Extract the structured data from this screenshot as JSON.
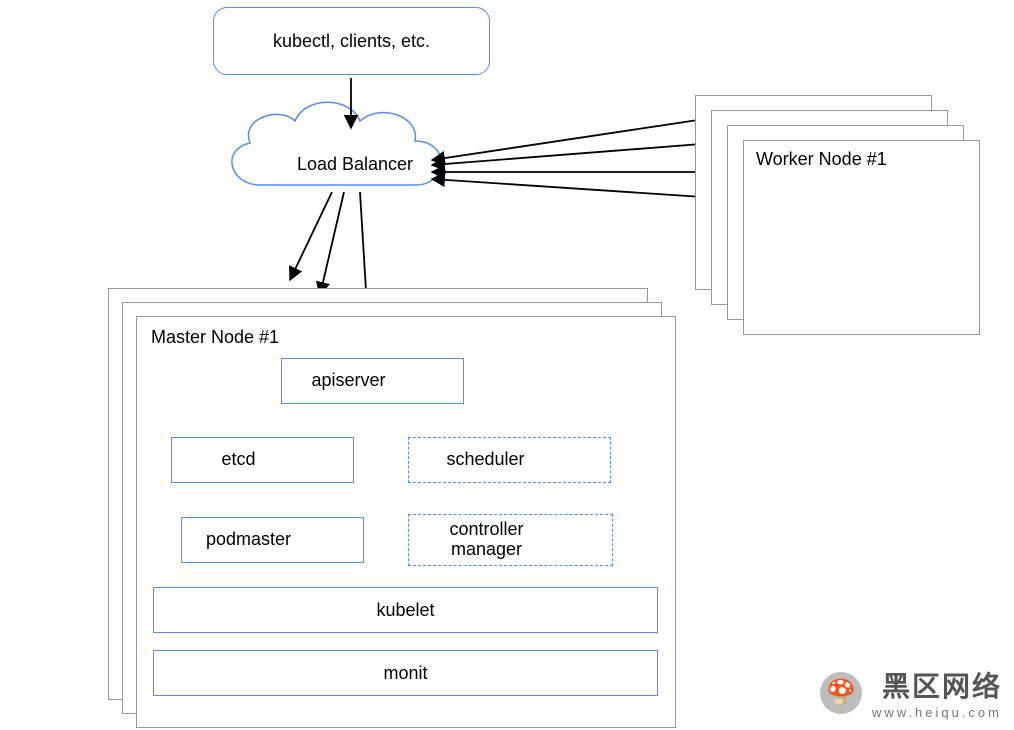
{
  "diagram": {
    "clients_box": "kubectl, clients, etc.",
    "load_balancer": "Load Balancer",
    "master": {
      "title_front": "Master Node #1",
      "components": {
        "apiserver": "apiserver",
        "etcd": "etcd",
        "podmaster": "podmaster",
        "scheduler": "scheduler",
        "controller": "controller\nmanager",
        "kubelet": "kubelet",
        "monit": "monit"
      }
    },
    "worker": {
      "title_front": "Worker Node #1"
    }
  },
  "watermark": {
    "main": "黑区网络",
    "sub": "www.heiqu.com"
  },
  "colors": {
    "blue": "#548bff",
    "grey": "#9a9a9a",
    "gear": "#1e78ff"
  }
}
